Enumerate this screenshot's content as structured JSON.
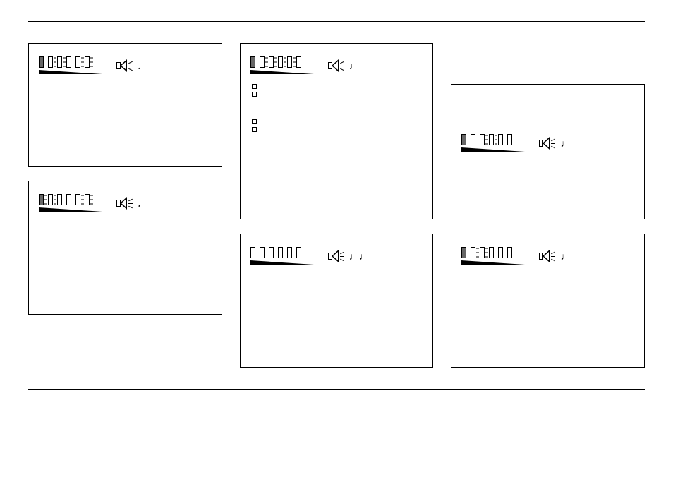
{
  "boxes": [
    {
      "id": "b1",
      "pattern": [
        "filled",
        "plain",
        "burst",
        "plain",
        "plain",
        "burst"
      ],
      "noteGlyph": "♩"
    },
    {
      "id": "b2",
      "pattern": [
        "filled",
        "burst",
        "plain",
        "plain",
        "plain",
        "burst"
      ],
      "noteGlyph": "♩"
    },
    {
      "id": "b3",
      "pattern": [
        "filled",
        "plain",
        "burst",
        "plain",
        "burst",
        "plain"
      ],
      "noteGlyph": "♩",
      "squares": 4
    },
    {
      "id": "b4",
      "pattern": [
        "plain",
        "plain",
        "plain",
        "plain",
        "plain",
        "plain"
      ],
      "noteGlyph": "♩♩"
    },
    {
      "id": "b5",
      "pattern": [
        "filled",
        "plain",
        "plain",
        "burst",
        "plain",
        "plain"
      ],
      "noteGlyph": "♩"
    },
    {
      "id": "b6",
      "pattern": [
        "filled",
        "plain",
        "burst",
        "plain",
        "plain",
        "plain"
      ],
      "noteGlyph": "♩"
    }
  ]
}
